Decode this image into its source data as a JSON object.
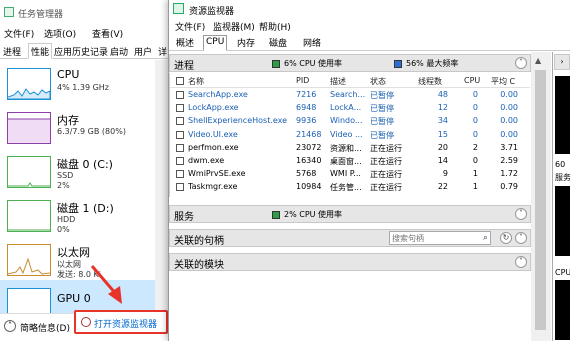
{
  "task_manager": {
    "title": "任务管理器",
    "menu": [
      "文件(F)",
      "选项(O)",
      "查看(V)"
    ],
    "tabs": [
      "进程",
      "性能",
      "应用历史记录",
      "启动",
      "用户",
      "详"
    ],
    "active_tab": 1,
    "side_items": [
      {
        "name": "CPU",
        "line1": "4% 1.39 GHz",
        "line2": "",
        "color": "#1e90d6"
      },
      {
        "name": "内存",
        "line1": "6.3/7.9 GB (80%)",
        "line2": "",
        "color": "#8b3fa8"
      },
      {
        "name": "磁盘 0 (C:)",
        "line1": "SSD",
        "line2": "2%",
        "color": "#4caf50"
      },
      {
        "name": "磁盘 1 (D:)",
        "line1": "HDD",
        "line2": "0%",
        "color": "#4caf50"
      },
      {
        "name": "以太网",
        "line1": "以太网",
        "line2": "发送: 8.0 Ki",
        "color": "#c98b2e"
      },
      {
        "name": "GPU 0",
        "line1": "",
        "line2": "",
        "color": "#1e90d6"
      }
    ],
    "overview_label": "简略信息(D)",
    "open_rm_label": "打开资源监视器",
    "highlight_color": "#e8332b"
  },
  "resource_monitor": {
    "title": "资源监视器",
    "menu": [
      "文件(F)",
      "监视器(M)",
      "帮助(H)"
    ],
    "tabs": [
      "概述",
      "CPU",
      "内存",
      "磁盘",
      "网络"
    ],
    "active_tab": 1,
    "processes": {
      "name": "进程",
      "cpu_usage": "6% CPU 使用率",
      "max_freq": "56% 最大频率",
      "columns": [
        "名称",
        "PID",
        "描述",
        "状态",
        "线程数",
        "CPU",
        "平均 C"
      ],
      "rows": [
        {
          "name": "SearchApp.exe",
          "pid": "7216",
          "desc": "Search...",
          "status": "已暂停",
          "threads": "48",
          "cpu": "0",
          "avg": "0.00",
          "suspended": true
        },
        {
          "name": "LockApp.exe",
          "pid": "6948",
          "desc": "LockA...",
          "status": "已暂停",
          "threads": "12",
          "cpu": "0",
          "avg": "0.00",
          "suspended": true
        },
        {
          "name": "ShellExperienceHost.exe",
          "pid": "9936",
          "desc": "Windo...",
          "status": "已暂停",
          "threads": "34",
          "cpu": "0",
          "avg": "0.00",
          "suspended": true
        },
        {
          "name": "Video.UI.exe",
          "pid": "21468",
          "desc": "Video ...",
          "status": "已暂停",
          "threads": "15",
          "cpu": "0",
          "avg": "0.00",
          "suspended": true
        },
        {
          "name": "perfmon.exe",
          "pid": "23072",
          "desc": "资源和...",
          "status": "正在运行",
          "threads": "20",
          "cpu": "2",
          "avg": "3.71",
          "suspended": false
        },
        {
          "name": "dwm.exe",
          "pid": "16340",
          "desc": "桌面窗...",
          "status": "正在运行",
          "threads": "14",
          "cpu": "0",
          "avg": "2.59",
          "suspended": false
        },
        {
          "name": "WmiPrvSE.exe",
          "pid": "5768",
          "desc": "WMI P...",
          "status": "正在运行",
          "threads": "9",
          "cpu": "1",
          "avg": "1.72",
          "suspended": false
        },
        {
          "name": "Taskmgr.exe",
          "pid": "10984",
          "desc": "任务管...",
          "status": "正在运行",
          "threads": "22",
          "cpu": "1",
          "avg": "0.79",
          "suspended": false
        }
      ]
    },
    "services": {
      "name": "服务",
      "cpu_usage": "2% CPU 使用率"
    },
    "handles": {
      "name": "关联的句柄",
      "search_placeholder": "搜索句柄"
    },
    "modules": {
      "name": "关联的模块"
    },
    "right_labels": {
      "a": "60",
      "b": "服务",
      "c": "CPU"
    },
    "accent_green": "#2e9e46",
    "accent_blue": "#2a6fd1"
  }
}
